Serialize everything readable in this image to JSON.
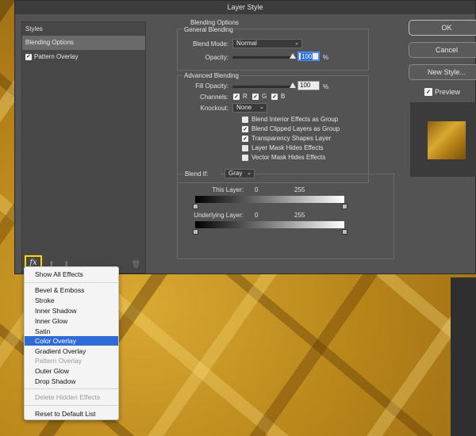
{
  "dialog": {
    "title": "Layer Style"
  },
  "styles_panel": {
    "header": "Styles",
    "items": [
      {
        "label": "Blending Options",
        "selected": true
      },
      {
        "label": "Pattern Overlay",
        "checked": true
      }
    ],
    "fx_label": "fx"
  },
  "general": {
    "section": "Blending Options",
    "subsection": "General Blending",
    "blend_mode_label": "Blend Mode:",
    "blend_mode_value": "Normal",
    "opacity_label": "Opacity:",
    "opacity_value": "100",
    "opacity_unit": "%"
  },
  "advanced": {
    "title": "Advanced Blending",
    "fill_label": "Fill Opacity:",
    "fill_value": "100",
    "fill_unit": "%",
    "channels_label": "Channels:",
    "channels": [
      "R",
      "G",
      "B"
    ],
    "knockout_label": "Knockout:",
    "knockout_value": "None",
    "options": [
      {
        "label": "Blend Interior Effects as Group",
        "checked": false
      },
      {
        "label": "Blend Clipped Layers as Group",
        "checked": true
      },
      {
        "label": "Transparency Shapes Layer",
        "checked": true
      },
      {
        "label": "Layer Mask Hides Effects",
        "checked": false
      },
      {
        "label": "Vector Mask Hides Effects",
        "checked": false
      }
    ]
  },
  "blend_if": {
    "label": "Blend If:",
    "value": "Gray",
    "this_layer_label": "This Layer:",
    "this_layer_min": "0",
    "this_layer_max": "255",
    "underlying_label": "Underlying Layer:",
    "underlying_min": "0",
    "underlying_max": "255"
  },
  "buttons": {
    "ok": "OK",
    "cancel": "Cancel",
    "new_style": "New Style..."
  },
  "preview": {
    "label": "Preview",
    "checked": true
  },
  "menu": {
    "items": [
      {
        "label": "Show All Effects",
        "disabled": false
      },
      {
        "label": "Bevel & Emboss",
        "disabled": false
      },
      {
        "label": "Stroke",
        "disabled": false
      },
      {
        "label": "Inner Shadow",
        "disabled": false
      },
      {
        "label": "Inner Glow",
        "disabled": false
      },
      {
        "label": "Satin",
        "disabled": false
      },
      {
        "label": "Color Overlay",
        "highlighted": true
      },
      {
        "label": "Gradient Overlay",
        "disabled": false
      },
      {
        "label": "Pattern Overlay",
        "disabled": true
      },
      {
        "label": "Outer Glow",
        "disabled": false
      },
      {
        "label": "Drop Shadow",
        "disabled": false
      },
      {
        "label": "Delete Hidden Effects",
        "disabled": true
      },
      {
        "label": "Reset to Default List",
        "disabled": false
      }
    ]
  }
}
